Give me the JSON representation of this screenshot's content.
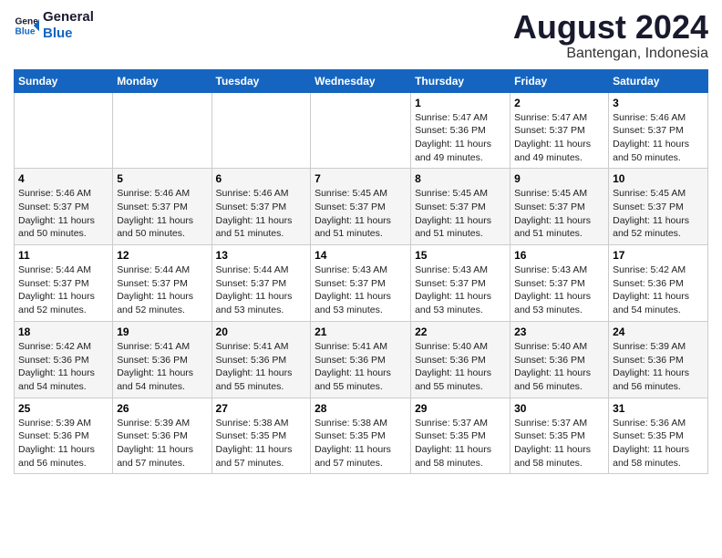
{
  "logo": {
    "line1": "General",
    "line2": "Blue"
  },
  "title": "August 2024",
  "location": "Bantengan, Indonesia",
  "days_of_week": [
    "Sunday",
    "Monday",
    "Tuesday",
    "Wednesday",
    "Thursday",
    "Friday",
    "Saturday"
  ],
  "weeks": [
    [
      {
        "day": "",
        "info": ""
      },
      {
        "day": "",
        "info": ""
      },
      {
        "day": "",
        "info": ""
      },
      {
        "day": "",
        "info": ""
      },
      {
        "day": "1",
        "info": "Sunrise: 5:47 AM\nSunset: 5:36 PM\nDaylight: 11 hours and 49 minutes."
      },
      {
        "day": "2",
        "info": "Sunrise: 5:47 AM\nSunset: 5:37 PM\nDaylight: 11 hours and 49 minutes."
      },
      {
        "day": "3",
        "info": "Sunrise: 5:46 AM\nSunset: 5:37 PM\nDaylight: 11 hours and 50 minutes."
      }
    ],
    [
      {
        "day": "4",
        "info": "Sunrise: 5:46 AM\nSunset: 5:37 PM\nDaylight: 11 hours and 50 minutes."
      },
      {
        "day": "5",
        "info": "Sunrise: 5:46 AM\nSunset: 5:37 PM\nDaylight: 11 hours and 50 minutes."
      },
      {
        "day": "6",
        "info": "Sunrise: 5:46 AM\nSunset: 5:37 PM\nDaylight: 11 hours and 51 minutes."
      },
      {
        "day": "7",
        "info": "Sunrise: 5:45 AM\nSunset: 5:37 PM\nDaylight: 11 hours and 51 minutes."
      },
      {
        "day": "8",
        "info": "Sunrise: 5:45 AM\nSunset: 5:37 PM\nDaylight: 11 hours and 51 minutes."
      },
      {
        "day": "9",
        "info": "Sunrise: 5:45 AM\nSunset: 5:37 PM\nDaylight: 11 hours and 51 minutes."
      },
      {
        "day": "10",
        "info": "Sunrise: 5:45 AM\nSunset: 5:37 PM\nDaylight: 11 hours and 52 minutes."
      }
    ],
    [
      {
        "day": "11",
        "info": "Sunrise: 5:44 AM\nSunset: 5:37 PM\nDaylight: 11 hours and 52 minutes."
      },
      {
        "day": "12",
        "info": "Sunrise: 5:44 AM\nSunset: 5:37 PM\nDaylight: 11 hours and 52 minutes."
      },
      {
        "day": "13",
        "info": "Sunrise: 5:44 AM\nSunset: 5:37 PM\nDaylight: 11 hours and 53 minutes."
      },
      {
        "day": "14",
        "info": "Sunrise: 5:43 AM\nSunset: 5:37 PM\nDaylight: 11 hours and 53 minutes."
      },
      {
        "day": "15",
        "info": "Sunrise: 5:43 AM\nSunset: 5:37 PM\nDaylight: 11 hours and 53 minutes."
      },
      {
        "day": "16",
        "info": "Sunrise: 5:43 AM\nSunset: 5:37 PM\nDaylight: 11 hours and 53 minutes."
      },
      {
        "day": "17",
        "info": "Sunrise: 5:42 AM\nSunset: 5:36 PM\nDaylight: 11 hours and 54 minutes."
      }
    ],
    [
      {
        "day": "18",
        "info": "Sunrise: 5:42 AM\nSunset: 5:36 PM\nDaylight: 11 hours and 54 minutes."
      },
      {
        "day": "19",
        "info": "Sunrise: 5:41 AM\nSunset: 5:36 PM\nDaylight: 11 hours and 54 minutes."
      },
      {
        "day": "20",
        "info": "Sunrise: 5:41 AM\nSunset: 5:36 PM\nDaylight: 11 hours and 55 minutes."
      },
      {
        "day": "21",
        "info": "Sunrise: 5:41 AM\nSunset: 5:36 PM\nDaylight: 11 hours and 55 minutes."
      },
      {
        "day": "22",
        "info": "Sunrise: 5:40 AM\nSunset: 5:36 PM\nDaylight: 11 hours and 55 minutes."
      },
      {
        "day": "23",
        "info": "Sunrise: 5:40 AM\nSunset: 5:36 PM\nDaylight: 11 hours and 56 minutes."
      },
      {
        "day": "24",
        "info": "Sunrise: 5:39 AM\nSunset: 5:36 PM\nDaylight: 11 hours and 56 minutes."
      }
    ],
    [
      {
        "day": "25",
        "info": "Sunrise: 5:39 AM\nSunset: 5:36 PM\nDaylight: 11 hours and 56 minutes."
      },
      {
        "day": "26",
        "info": "Sunrise: 5:39 AM\nSunset: 5:36 PM\nDaylight: 11 hours and 57 minutes."
      },
      {
        "day": "27",
        "info": "Sunrise: 5:38 AM\nSunset: 5:35 PM\nDaylight: 11 hours and 57 minutes."
      },
      {
        "day": "28",
        "info": "Sunrise: 5:38 AM\nSunset: 5:35 PM\nDaylight: 11 hours and 57 minutes."
      },
      {
        "day": "29",
        "info": "Sunrise: 5:37 AM\nSunset: 5:35 PM\nDaylight: 11 hours and 58 minutes."
      },
      {
        "day": "30",
        "info": "Sunrise: 5:37 AM\nSunset: 5:35 PM\nDaylight: 11 hours and 58 minutes."
      },
      {
        "day": "31",
        "info": "Sunrise: 5:36 AM\nSunset: 5:35 PM\nDaylight: 11 hours and 58 minutes."
      }
    ]
  ]
}
